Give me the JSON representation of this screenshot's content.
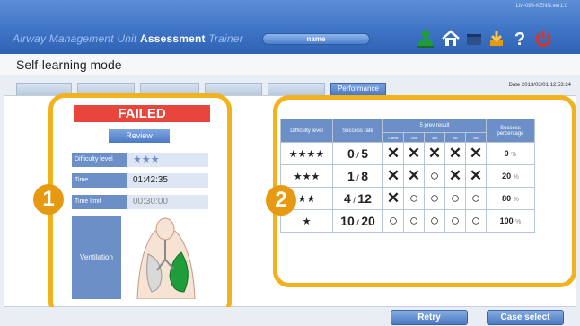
{
  "header": {
    "model": "LM-093-KENN.ver1.0",
    "title_pre": "Airway Management Unit ",
    "title_mid": "Assessment",
    "title_post": " Trainer",
    "name_label": "name",
    "icons": [
      "person-icon",
      "home-icon",
      "book-icon",
      "download-icon",
      "help-icon",
      "power-icon"
    ],
    "colors": {
      "green": "#1f9d3a",
      "blue": "#2f62b3",
      "orange": "#e69a12",
      "red": "#d9352b"
    }
  },
  "mode": {
    "title": "Self-learning mode",
    "active_tab": "Performance",
    "datetime": "Date 2013/03/01 12:53:24"
  },
  "result": {
    "status": "FAILED",
    "review_label": "Review",
    "difficulty_label": "Difficulty level",
    "difficulty_stars": "★★★",
    "time_label": "Time",
    "time_value": "01:42:35",
    "limit_label": "Time limit",
    "limit_value": "00:30:00",
    "ventilation_label": "Ventilation"
  },
  "table": {
    "headers": {
      "difficulty": "Difficulty level",
      "success_rate": "Success rate",
      "prev": "5 prev result",
      "percentage": "Success percentage"
    },
    "prev_subheaders": [
      "Latest",
      "2nd",
      "3rd",
      "4th",
      "5th"
    ],
    "rows": [
      {
        "stars": "★★★★",
        "success": "0",
        "total": "5",
        "marks": [
          "✕",
          "✕",
          "✕",
          "✕",
          "✕"
        ],
        "pct": "0"
      },
      {
        "stars": "★★★",
        "success": "1",
        "total": "8",
        "marks": [
          "✕",
          "✕",
          "○",
          "✕",
          "✕"
        ],
        "pct": "20"
      },
      {
        "stars": "★★",
        "success": "4",
        "total": "12",
        "marks": [
          "✕",
          "○",
          "○",
          "○",
          "○"
        ],
        "pct": "80"
      },
      {
        "stars": "★",
        "success": "10",
        "total": "20",
        "marks": [
          "○",
          "○",
          "○",
          "○",
          "○"
        ],
        "pct": "100"
      }
    ],
    "pct_unit": "%"
  },
  "callouts": [
    "1",
    "2"
  ],
  "buttons": {
    "retry": "Retry",
    "case_select": "Case select"
  }
}
